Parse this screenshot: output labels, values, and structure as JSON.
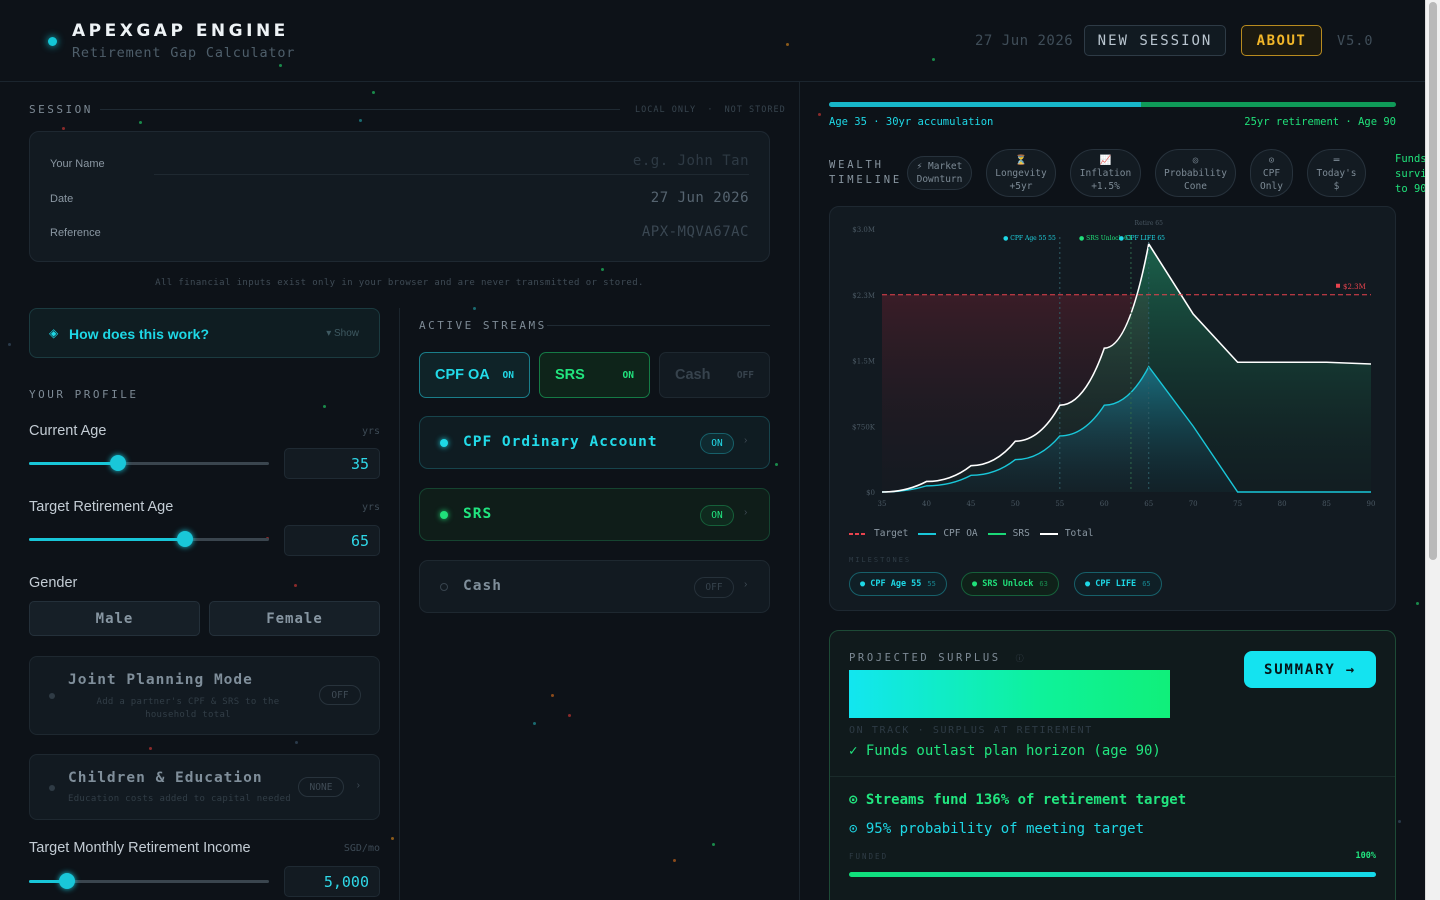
{
  "header": {
    "title": "APEXGAP ENGINE",
    "subtitle": "Retirement Gap Calculator",
    "date": "27 Jun 2026",
    "new_session": "NEW SESSION",
    "about": "ABOUT",
    "version": "V5.0"
  },
  "session": {
    "label": "SESSION",
    "storage_note_1": "LOCAL ONLY",
    "storage_note_sep": "·",
    "storage_note_2": "NOT STORED",
    "fields": [
      {
        "label": "Your Name",
        "placeholder": "e.g. John Tan"
      },
      {
        "label": "Date",
        "value": "27 Jun 2026"
      },
      {
        "label": "Reference",
        "value": "APX-MQVA67AC"
      }
    ],
    "privacy": "All financial inputs exist only in your browser and are never transmitted or stored."
  },
  "help": {
    "title": "How does this work?",
    "toggle": "▾ Show"
  },
  "profile": {
    "label": "YOUR PROFILE",
    "current_age": {
      "label": "Current Age",
      "unit": "yrs",
      "value": "35",
      "slider_fraction": 0.37
    },
    "retirement_age": {
      "label": "Target Retirement Age",
      "unit": "yrs",
      "value": "65",
      "slider_fraction": 0.65
    },
    "gender": {
      "label": "Gender",
      "options": [
        "Male",
        "Female"
      ]
    },
    "joint": {
      "title": "Joint Planning Mode",
      "sub": "Add a partner's CPF & SRS to the household total",
      "state": "OFF"
    },
    "children": {
      "title": "Children & Education",
      "sub": "Education costs added to capital needed",
      "state": "NONE",
      "chev": "›"
    },
    "income": {
      "label": "Target Monthly Retirement Income",
      "unit": "SGD/mo",
      "value": "5,000",
      "slider_fraction": 0.16
    }
  },
  "streams": {
    "label": "ACTIVE STREAMS",
    "toggles": [
      {
        "label": "CPF OA",
        "state": "ON"
      },
      {
        "label": "SRS",
        "state": "ON"
      },
      {
        "label": "Cash",
        "state": "OFF"
      }
    ],
    "cards": [
      {
        "title": "CPF Ordinary Account",
        "state": "ON",
        "chev": "›"
      },
      {
        "title": "SRS",
        "state": "ON",
        "chev": "›"
      },
      {
        "title": "Cash",
        "state": "OFF",
        "chev": "›"
      }
    ]
  },
  "timeline": {
    "accum_fraction": 0.55,
    "left": "Age 35 · 30yr accumulation",
    "right": "25yr retirement · Age 90"
  },
  "wealth": {
    "label_1": "WEALTH",
    "label_2": "TIMELINE",
    "scenarios": [
      {
        "l1": "⚡ Market",
        "l2": "Downturn"
      },
      {
        "l1": "⏳",
        "l2": "Longevity",
        "l3": "+5yr"
      },
      {
        "l1": "📈",
        "l2": "Inflation",
        "l3": "+1.5%"
      },
      {
        "l1": "◎",
        "l2": "Probability",
        "l3": "Cone"
      },
      {
        "l1": "⊙",
        "l2": "CPF",
        "l3": "Only"
      },
      {
        "l1": "═",
        "l2": "Today's",
        "l3": "$"
      }
    ],
    "funds_note": [
      "Funds",
      "survive",
      "to 90"
    ]
  },
  "chart_data": {
    "type": "area",
    "x": [
      35,
      40,
      45,
      50,
      55,
      60,
      65,
      70,
      75,
      80,
      85,
      90
    ],
    "x_ticks": [
      "35",
      "40",
      "45",
      "50",
      "55",
      "60",
      "65",
      "70",
      "75",
      "80",
      "85",
      "90"
    ],
    "y_ticks": [
      "$0",
      "$750K",
      "$1.5M",
      "$2.3M",
      "$3.0M"
    ],
    "ylim": [
      0,
      3000000
    ],
    "series": [
      {
        "name": "Total",
        "color": "#ffffff",
        "values": [
          0,
          120000,
          300000,
          580000,
          990000,
          1640000,
          2830000,
          2030000,
          1480000,
          1480000,
          1480000,
          1460000
        ]
      },
      {
        "name": "CPF OA",
        "color": "#19c7d9",
        "values": [
          0,
          70000,
          190000,
          370000,
          640000,
          990000,
          1430000,
          750000,
          0,
          0,
          0,
          0
        ]
      },
      {
        "name": "SRS",
        "color": "#1bd877",
        "values": []
      }
    ],
    "target": {
      "name": "Target",
      "value": 2250000,
      "label": "$2.3M",
      "color": "#e8434e"
    },
    "annotations": [
      {
        "x": 55,
        "text": "● CPF Age 55 55"
      },
      {
        "x": 63,
        "text": "● SRS Unlock 63"
      },
      {
        "x": 65,
        "text": "● CPF LIFE 65"
      },
      {
        "x": 65,
        "text": "Retire 65"
      }
    ],
    "legend": [
      "Target",
      "CPF OA",
      "SRS",
      "Total"
    ]
  },
  "milestones": {
    "label": "MILESTONES",
    "chips": [
      {
        "name": "● CPF Age 55",
        "age": "55",
        "color": "#1ed8e6"
      },
      {
        "name": "● SRS Unlock",
        "age": "63",
        "color": "#20e07a"
      },
      {
        "name": "● CPF LIFE",
        "age": "65",
        "color": "#1ed8e6"
      }
    ]
  },
  "surplus": {
    "label": "PROJECTED SURPLUS",
    "label_icon": "ⓘ",
    "summary": "SUMMARY →",
    "sub": "ON TRACK · SURPLUS AT RETIREMENT",
    "status": "✓ Funds outlast plan horizon (age 90)",
    "line1": "⊙ Streams fund 136% of retirement target",
    "line2": "⊙ 95% probability of meeting target",
    "funded_label": "FUNDED",
    "funded_pct": "100%",
    "funded_fraction": 1
  },
  "colors": {
    "accent_cyan": "#19c7d9",
    "accent_green": "#20e07a",
    "accent_gold": "#f1b629",
    "target_red": "#e8434e"
  }
}
